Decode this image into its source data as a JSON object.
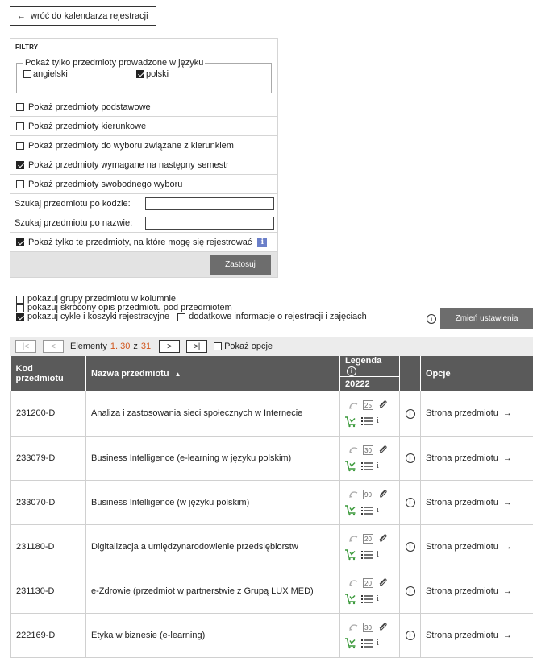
{
  "back_button": {
    "label": "wróć do kalendarza rejestracji"
  },
  "filters": {
    "heading": "FILTRY",
    "language_legend": "Pokaż tylko przedmioty prowadzone w języku",
    "languages": [
      {
        "label": "angielski",
        "checked": false
      },
      {
        "label": "polski",
        "checked": true
      }
    ],
    "checkboxes": [
      {
        "label": "Pokaż przedmioty podstawowe",
        "checked": false
      },
      {
        "label": "Pokaż przedmioty kierunkowe",
        "checked": false
      },
      {
        "label": "Pokaż przedmioty do wyboru związane z kierunkiem",
        "checked": false
      },
      {
        "label": "Pokaż przedmioty wymagane na następny semestr",
        "checked": true
      },
      {
        "label": "Pokaż przedmioty swobodnego wyboru",
        "checked": false
      }
    ],
    "search_code_label": "Szukaj przedmiotu po kodzie:",
    "search_code_value": "",
    "search_name_label": "Szukaj przedmiotu po nazwie:",
    "search_name_value": "",
    "registrable_only_label": "Pokaż tylko te przedmioty, na które mogę się rejestrować",
    "registrable_only_checked": true,
    "apply_label": "Zastosuj"
  },
  "display_options": {
    "groups_in_column": "pokazuj grupy przedmiotu w kolumnie",
    "short_description": "pokazuj skrócony opis przedmiotu pod przedmiotem",
    "cycles_and_carts": "pokazuj cykle i koszyki rejestracyjne",
    "additional_info": "dodatkowe informacje o rejestracji i zajęciach",
    "change_settings": "Zmień ustawienia"
  },
  "pager": {
    "first": "|<",
    "prev": "<",
    "next": ">",
    "last": ">|",
    "elements_label": "Elementy",
    "range": "1..30",
    "of": "z",
    "total": "31",
    "show_options": "Pokaż opcje"
  },
  "table": {
    "col_code": "Kod przedmiotu",
    "col_name": "Nazwa przedmiotu",
    "sort_indicator": "▲",
    "col_legend": "Legenda",
    "col_cycle": "20222",
    "col_options": "Opcje",
    "rows": [
      {
        "code": "231200-D",
        "name": "Analiza i zastosowania sieci społecznych w Internecie",
        "capacity": "25",
        "link": "Strona przedmiotu"
      },
      {
        "code": "233079-D",
        "name": "Business Intelligence (e-learning w języku polskim)",
        "capacity": "30",
        "link": "Strona przedmiotu"
      },
      {
        "code": "233070-D",
        "name": "Business Intelligence (w języku polskim)",
        "capacity": "90",
        "link": "Strona przedmiotu"
      },
      {
        "code": "231180-D",
        "name": "Digitalizacja a umiędzynarodowienie przedsiębiorstw",
        "capacity": "20",
        "link": "Strona przedmiotu"
      },
      {
        "code": "231130-D",
        "name": "e-Zdrowie (przedmiot w partnerstwie z Grupą LUX MED)",
        "capacity": "20",
        "link": "Strona przedmiotu"
      },
      {
        "code": "222169-D",
        "name": "Etyka w biznesie (e-learning)",
        "capacity": "30",
        "link": "Strona przedmiotu"
      }
    ]
  },
  "icons": {
    "info": "i",
    "arrow_left": "←",
    "arrow_right": "→"
  },
  "colors": {
    "header_bg": "#5a5a5a",
    "button_bg": "#6d6d6d",
    "cart_green": "#3c9a3c",
    "info_blue": "#6b7fc9",
    "pager_orange": "#d0541b"
  }
}
